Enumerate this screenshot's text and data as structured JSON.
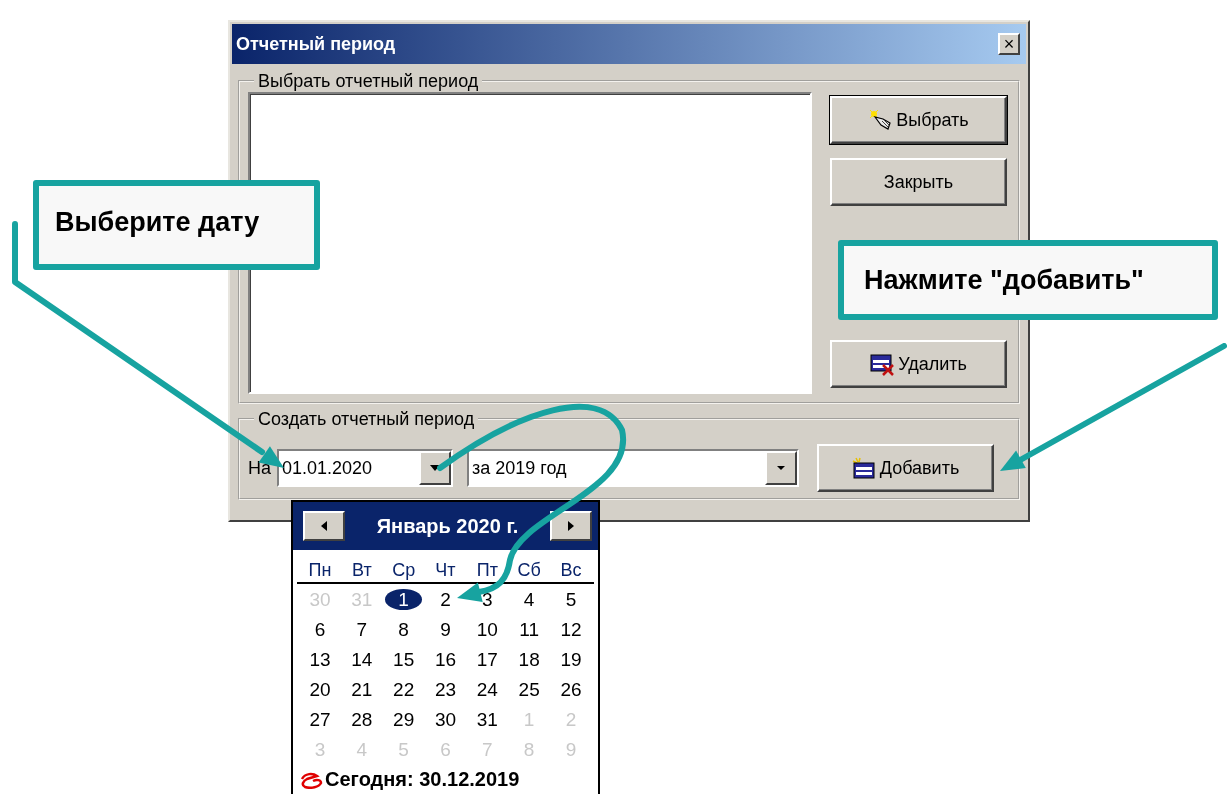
{
  "window": {
    "title": "Отчетный период",
    "close_label": "×"
  },
  "select_group": {
    "legend": "Выбрать отчетный период",
    "buttons": [
      {
        "label": "Выбрать",
        "kind": "select",
        "default": true
      },
      {
        "label": "Закрыть",
        "kind": "plain",
        "default": false
      },
      {
        "label": "Удалить",
        "kind": "delete",
        "default": false
      }
    ]
  },
  "create_group": {
    "legend": "Создать отчетный период",
    "date_label": "На",
    "date_value": "01.01.2020",
    "period_value": "за 2019 год",
    "add_button": "Добавить"
  },
  "calendar": {
    "month_title": "Январь 2020 г.",
    "weekdays": [
      "Пн",
      "Вт",
      "Ср",
      "Чт",
      "Пт",
      "Сб",
      "Вс"
    ],
    "weeks": [
      [
        {
          "day": "30",
          "muted": true,
          "selected": false
        },
        {
          "day": "31",
          "muted": true,
          "selected": false
        },
        {
          "day": "1",
          "muted": false,
          "selected": true
        },
        {
          "day": "2",
          "muted": false,
          "selected": false
        },
        {
          "day": "3",
          "muted": false,
          "selected": false
        },
        {
          "day": "4",
          "muted": false,
          "selected": false
        },
        {
          "day": "5",
          "muted": false,
          "selected": false
        }
      ],
      [
        {
          "day": "6",
          "muted": false,
          "selected": false
        },
        {
          "day": "7",
          "muted": false,
          "selected": false
        },
        {
          "day": "8",
          "muted": false,
          "selected": false
        },
        {
          "day": "9",
          "muted": false,
          "selected": false
        },
        {
          "day": "10",
          "muted": false,
          "selected": false
        },
        {
          "day": "11",
          "muted": false,
          "selected": false
        },
        {
          "day": "12",
          "muted": false,
          "selected": false
        }
      ],
      [
        {
          "day": "13",
          "muted": false,
          "selected": false
        },
        {
          "day": "14",
          "muted": false,
          "selected": false
        },
        {
          "day": "15",
          "muted": false,
          "selected": false
        },
        {
          "day": "16",
          "muted": false,
          "selected": false
        },
        {
          "day": "17",
          "muted": false,
          "selected": false
        },
        {
          "day": "18",
          "muted": false,
          "selected": false
        },
        {
          "day": "19",
          "muted": false,
          "selected": false
        }
      ],
      [
        {
          "day": "20",
          "muted": false,
          "selected": false
        },
        {
          "day": "21",
          "muted": false,
          "selected": false
        },
        {
          "day": "22",
          "muted": false,
          "selected": false
        },
        {
          "day": "23",
          "muted": false,
          "selected": false
        },
        {
          "day": "24",
          "muted": false,
          "selected": false
        },
        {
          "day": "25",
          "muted": false,
          "selected": false
        },
        {
          "day": "26",
          "muted": false,
          "selected": false
        }
      ],
      [
        {
          "day": "27",
          "muted": false,
          "selected": false
        },
        {
          "day": "28",
          "muted": false,
          "selected": false
        },
        {
          "day": "29",
          "muted": false,
          "selected": false
        },
        {
          "day": "30",
          "muted": false,
          "selected": false
        },
        {
          "day": "31",
          "muted": false,
          "selected": false
        },
        {
          "day": "1",
          "muted": true,
          "selected": false
        },
        {
          "day": "2",
          "muted": true,
          "selected": false
        }
      ],
      [
        {
          "day": "3",
          "muted": true,
          "selected": false
        },
        {
          "day": "4",
          "muted": true,
          "selected": false
        },
        {
          "day": "5",
          "muted": true,
          "selected": false
        },
        {
          "day": "6",
          "muted": true,
          "selected": false
        },
        {
          "day": "7",
          "muted": true,
          "selected": false
        },
        {
          "day": "8",
          "muted": true,
          "selected": false
        },
        {
          "day": "9",
          "muted": true,
          "selected": false
        }
      ]
    ],
    "today_label": "Сегодня: 30.12.2019"
  },
  "callouts": [
    {
      "text": "Выберите дату",
      "kind": "left"
    },
    {
      "text": "Нажмите \"добавить\"",
      "kind": "right"
    }
  ]
}
